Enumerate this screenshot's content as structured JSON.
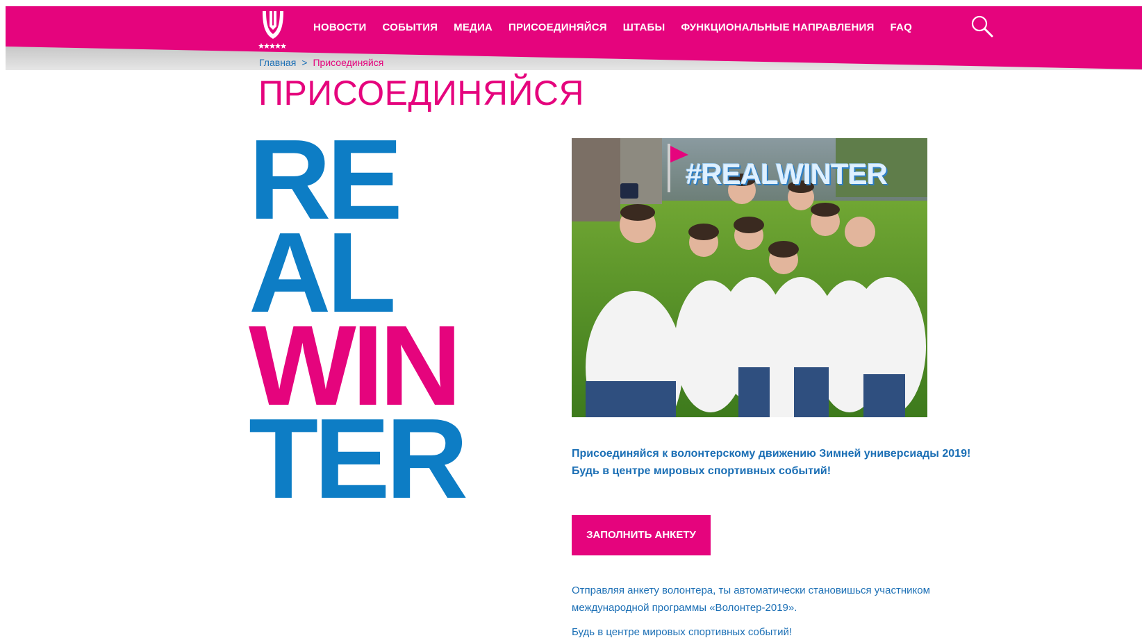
{
  "colors": {
    "brand_pink": "#e5047d",
    "brand_blue": "#0d7dc5",
    "link_blue": "#1b6fb5",
    "white": "#ffffff"
  },
  "header": {
    "logo_icon": "universiade-logo-icon",
    "nav": [
      {
        "label": "НОВОСТИ"
      },
      {
        "label": "СОБЫТИЯ"
      },
      {
        "label": "МЕДИА"
      },
      {
        "label": "ПРИСОЕДИНЯЙСЯ"
      },
      {
        "label": "ШТАБЫ"
      },
      {
        "label": "ФУНКЦИОНАЛЬНЫЕ НАПРАВЛЕНИЯ"
      },
      {
        "label": "FAQ"
      }
    ],
    "search_icon": "search-icon"
  },
  "breadcrumb": {
    "home": "Главная",
    "separator": ">",
    "current": "Присоединяйся"
  },
  "page": {
    "title": "ПРИСОЕДИНЯЙСЯ",
    "big_lettering": [
      "RE",
      "AL",
      "WIN",
      "TER"
    ],
    "hero_hashtag": "#REALWINTER",
    "lead": "Присоединяйся к волонтерскому движению Зимней универсиады 2019! Будь в центре мировых спортивных событий!",
    "cta_label": "ЗАПОЛНИТЬ АНКЕТУ",
    "note_1": "Отправляя анкету волонтера, ты автоматически становишься участником международной программы «Волонтер-2019».",
    "note_2": "Будь в центре мировых спортивных событий!"
  }
}
